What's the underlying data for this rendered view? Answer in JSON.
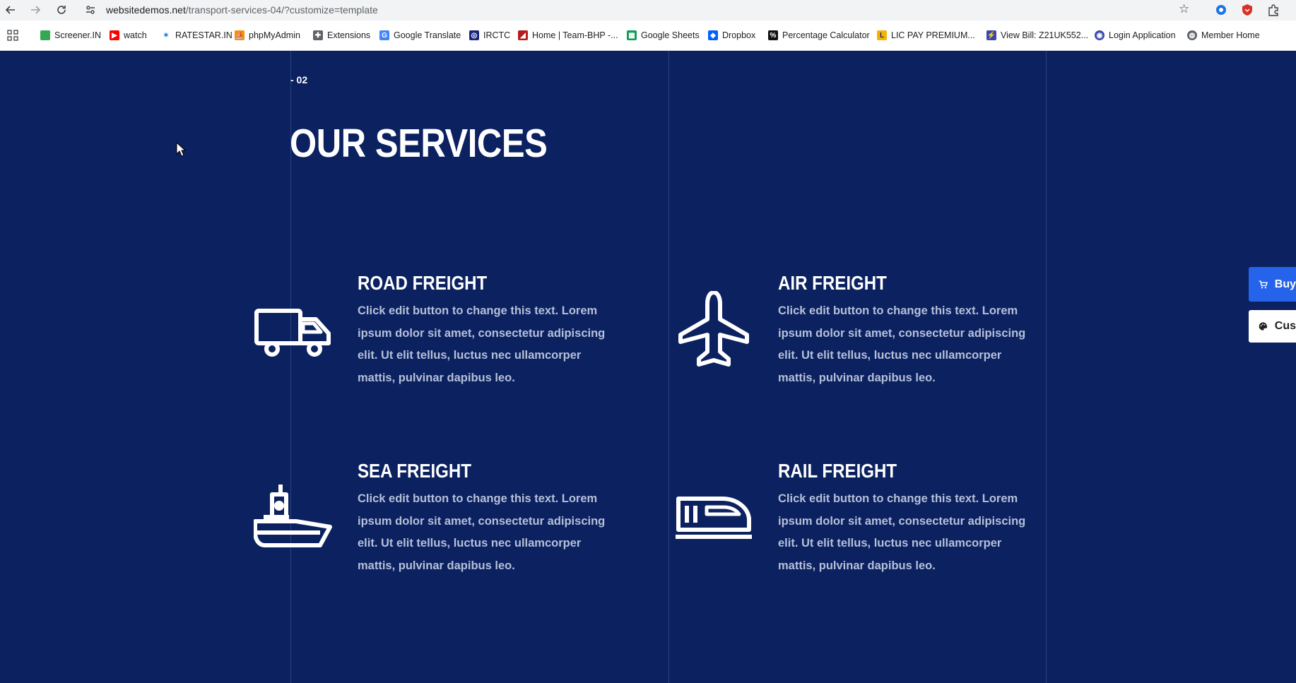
{
  "browser": {
    "url_domain": "websitedemos.net",
    "url_path": "/transport-services-04/?customize=template",
    "bookmarks": [
      {
        "label": "Screener.IN",
        "icon": "bar-chart-icon",
        "color": "#34a853"
      },
      {
        "label": "watch",
        "icon": "youtube-icon",
        "color": "#ff0000"
      },
      {
        "label": "RATESTAR.IN",
        "icon": "ratestar-icon",
        "color": "#1a73e8"
      },
      {
        "label": "phpMyAdmin",
        "icon": "phpmyadmin-icon",
        "color": "#f29111"
      },
      {
        "label": "Extensions",
        "icon": "puzzle-icon",
        "color": "#5f6368"
      },
      {
        "label": "Google Translate",
        "icon": "translate-icon",
        "color": "#4285f4"
      },
      {
        "label": "IRCTC",
        "icon": "irctc-icon",
        "color": "#1a237e"
      },
      {
        "label": "Home | Team-BHP -...",
        "icon": "teambhp-icon",
        "color": "#b71c1c"
      },
      {
        "label": "Google Sheets",
        "icon": "sheets-icon",
        "color": "#0f9d58"
      },
      {
        "label": "Dropbox",
        "icon": "dropbox-icon",
        "color": "#0061ff"
      },
      {
        "label": "Percentage Calculator",
        "icon": "percent-icon",
        "color": "#111111"
      },
      {
        "label": "LIC PAY PREMIUM...",
        "icon": "lic-icon",
        "color": "#f4b400"
      },
      {
        "label": "View Bill: Z21UK552...",
        "icon": "bill-icon",
        "color": "#3949ab"
      },
      {
        "label": "Login Application",
        "icon": "login-icon",
        "color": "#3949ab"
      },
      {
        "label": "Member Home",
        "icon": "globe-icon",
        "color": "#5f6368"
      }
    ]
  },
  "page": {
    "background": "#0b2160",
    "section_number": "- 02",
    "section_title": "OUR SERVICES",
    "services": [
      {
        "title": "ROAD FREIGHT",
        "icon": "truck-icon",
        "text": "Click edit button to change this text. Lorem ipsum dolor sit amet, consectetur adipiscing elit. Ut elit tellus, luctus nec ullamcorper mattis, pulvinar dapibus leo."
      },
      {
        "title": "AIR FREIGHT",
        "icon": "airplane-icon",
        "text": "Click edit button to change this text. Lorem ipsum dolor sit amet, consectetur adipiscing elit. Ut elit tellus, luctus nec ullamcorper mattis, pulvinar dapibus leo."
      },
      {
        "title": "SEA FREIGHT",
        "icon": "ship-icon",
        "text": "Click edit button to change this text. Lorem ipsum dolor sit amet, consectetur adipiscing elit. Ut elit tellus, luctus nec ullamcorper mattis, pulvinar dapibus leo."
      },
      {
        "title": "RAIL FREIGHT",
        "icon": "train-icon",
        "text": "Click edit button to change this text. Lorem ipsum dolor sit amet, consectetur adipiscing elit. Ut elit tellus, luctus nec ullamcorper mattis, pulvinar dapibus leo."
      }
    ]
  },
  "floating": {
    "buy_label": "Buy",
    "customize_label": "Cus"
  }
}
